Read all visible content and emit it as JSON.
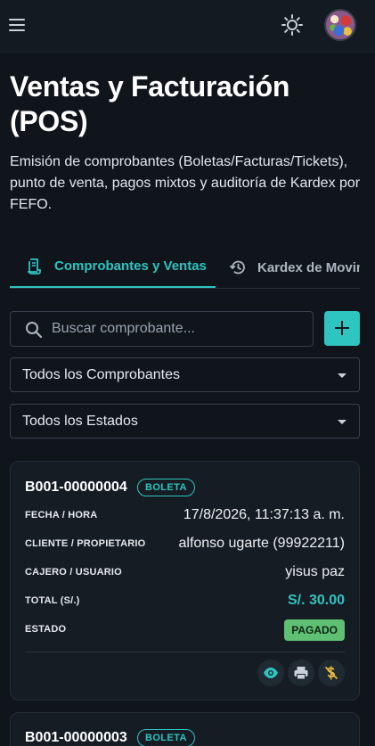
{
  "page": {
    "title": "Ventas y Facturación (POS)",
    "description": "Emisión de comprobantes (Boletas/Facturas/Tickets), punto de venta, pagos mixtos y auditoría de Kardex por FEFO."
  },
  "tabs": [
    {
      "label": "Comprobantes y Ventas",
      "icon": "receipt-icon",
      "active": true
    },
    {
      "label": "Kardex de Movimientos",
      "icon": "history-icon",
      "active": false
    }
  ],
  "search": {
    "placeholder": "Buscar comprobante..."
  },
  "filters": {
    "tipo": {
      "selected": "Todos los Comprobantes"
    },
    "estado": {
      "selected": "Todos los Estados"
    }
  },
  "labels": {
    "fecha": "FECHA / HORA",
    "cliente": "CLIENTE / PROPIETARIO",
    "cajero": "CAJERO / USUARIO",
    "total": "TOTAL (S/.)",
    "estado": "ESTADO"
  },
  "receipts": [
    {
      "number": "B001-00000004",
      "type": "BOLETA",
      "datetime": "17/8/2026, 11:37:13 a. m.",
      "client": "alfonso ugarte (99922211)",
      "cashier": "yisus paz",
      "total": "S/. 30.00",
      "status": "PAGADO"
    },
    {
      "number": "B001-00000003",
      "type": "BOLETA"
    }
  ],
  "colors": {
    "accent": "#2ec4c0",
    "paid": "#5fbf73",
    "background": "#10151c"
  }
}
